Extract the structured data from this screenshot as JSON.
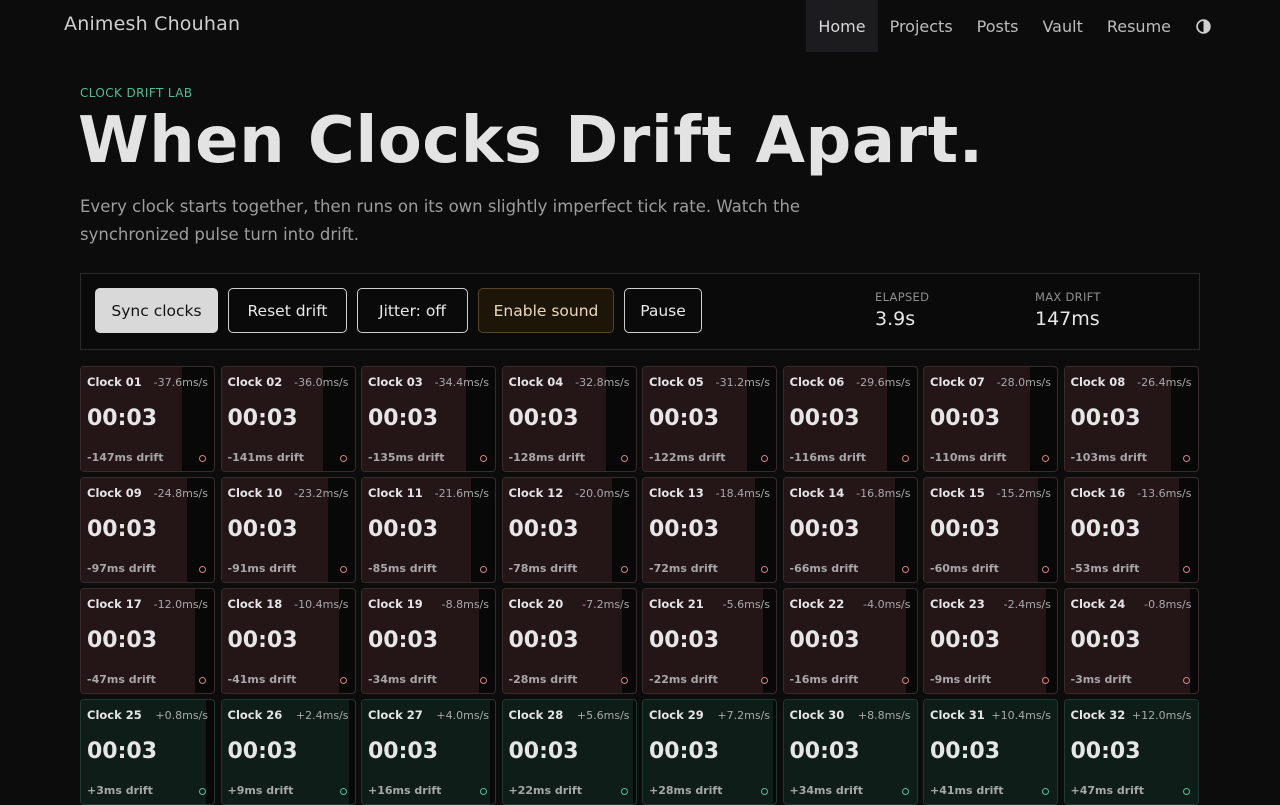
{
  "nav": {
    "brand": "Animesh Chouhan",
    "links": [
      "Home",
      "Projects",
      "Posts",
      "Vault",
      "Resume"
    ],
    "active": "Home",
    "toggle_icon": "contrast-icon"
  },
  "header": {
    "eyebrow": "CLOCK DRIFT LAB",
    "title": "When Clocks Drift Apart.",
    "description": "Every clock starts together, then runs on its own slightly imperfect tick rate. Watch the synchronized pulse turn into drift."
  },
  "controls": {
    "sync": "Sync clocks",
    "reset": "Reset drift",
    "jitter": "Jitter: off",
    "sound": "Enable sound",
    "pause": "Pause"
  },
  "stats": {
    "elapsed_label": "ELAPSED",
    "elapsed_value": "3.9s",
    "maxdrift_label": "MAX DRIFT",
    "maxdrift_value": "147ms"
  },
  "colors": {
    "accent": "#4fbf93",
    "negative_fill": "#241516",
    "positive_fill": "#0f1d19"
  },
  "clocks": [
    {
      "name": "Clock 01",
      "rate": "-37.6ms/s",
      "time": "00:03",
      "drift": "-147ms drift"
    },
    {
      "name": "Clock 02",
      "rate": "-36.0ms/s",
      "time": "00:03",
      "drift": "-141ms drift"
    },
    {
      "name": "Clock 03",
      "rate": "-34.4ms/s",
      "time": "00:03",
      "drift": "-135ms drift"
    },
    {
      "name": "Clock 04",
      "rate": "-32.8ms/s",
      "time": "00:03",
      "drift": "-128ms drift"
    },
    {
      "name": "Clock 05",
      "rate": "-31.2ms/s",
      "time": "00:03",
      "drift": "-122ms drift"
    },
    {
      "name": "Clock 06",
      "rate": "-29.6ms/s",
      "time": "00:03",
      "drift": "-116ms drift"
    },
    {
      "name": "Clock 07",
      "rate": "-28.0ms/s",
      "time": "00:03",
      "drift": "-110ms drift"
    },
    {
      "name": "Clock 08",
      "rate": "-26.4ms/s",
      "time": "00:03",
      "drift": "-103ms drift"
    },
    {
      "name": "Clock 09",
      "rate": "-24.8ms/s",
      "time": "00:03",
      "drift": "-97ms drift"
    },
    {
      "name": "Clock 10",
      "rate": "-23.2ms/s",
      "time": "00:03",
      "drift": "-91ms drift"
    },
    {
      "name": "Clock 11",
      "rate": "-21.6ms/s",
      "time": "00:03",
      "drift": "-85ms drift"
    },
    {
      "name": "Clock 12",
      "rate": "-20.0ms/s",
      "time": "00:03",
      "drift": "-78ms drift"
    },
    {
      "name": "Clock 13",
      "rate": "-18.4ms/s",
      "time": "00:03",
      "drift": "-72ms drift"
    },
    {
      "name": "Clock 14",
      "rate": "-16.8ms/s",
      "time": "00:03",
      "drift": "-66ms drift"
    },
    {
      "name": "Clock 15",
      "rate": "-15.2ms/s",
      "time": "00:03",
      "drift": "-60ms drift"
    },
    {
      "name": "Clock 16",
      "rate": "-13.6ms/s",
      "time": "00:03",
      "drift": "-53ms drift"
    },
    {
      "name": "Clock 17",
      "rate": "-12.0ms/s",
      "time": "00:03",
      "drift": "-47ms drift"
    },
    {
      "name": "Clock 18",
      "rate": "-10.4ms/s",
      "time": "00:03",
      "drift": "-41ms drift"
    },
    {
      "name": "Clock 19",
      "rate": "-8.8ms/s",
      "time": "00:03",
      "drift": "-34ms drift"
    },
    {
      "name": "Clock 20",
      "rate": "-7.2ms/s",
      "time": "00:03",
      "drift": "-28ms drift"
    },
    {
      "name": "Clock 21",
      "rate": "-5.6ms/s",
      "time": "00:03",
      "drift": "-22ms drift"
    },
    {
      "name": "Clock 22",
      "rate": "-4.0ms/s",
      "time": "00:03",
      "drift": "-16ms drift"
    },
    {
      "name": "Clock 23",
      "rate": "-2.4ms/s",
      "time": "00:03",
      "drift": "-9ms drift"
    },
    {
      "name": "Clock 24",
      "rate": "-0.8ms/s",
      "time": "00:03",
      "drift": "-3ms drift"
    },
    {
      "name": "Clock 25",
      "rate": "+0.8ms/s",
      "time": "00:03",
      "drift": "+3ms drift"
    },
    {
      "name": "Clock 26",
      "rate": "+2.4ms/s",
      "time": "00:03",
      "drift": "+9ms drift"
    },
    {
      "name": "Clock 27",
      "rate": "+4.0ms/s",
      "time": "00:03",
      "drift": "+16ms drift"
    },
    {
      "name": "Clock 28",
      "rate": "+5.6ms/s",
      "time": "00:03",
      "drift": "+22ms drift"
    },
    {
      "name": "Clock 29",
      "rate": "+7.2ms/s",
      "time": "00:03",
      "drift": "+28ms drift"
    },
    {
      "name": "Clock 30",
      "rate": "+8.8ms/s",
      "time": "00:03",
      "drift": "+34ms drift"
    },
    {
      "name": "Clock 31",
      "rate": "+10.4ms/s",
      "time": "00:03",
      "drift": "+41ms drift"
    },
    {
      "name": "Clock 32",
      "rate": "+12.0ms/s",
      "time": "00:03",
      "drift": "+47ms drift"
    }
  ]
}
